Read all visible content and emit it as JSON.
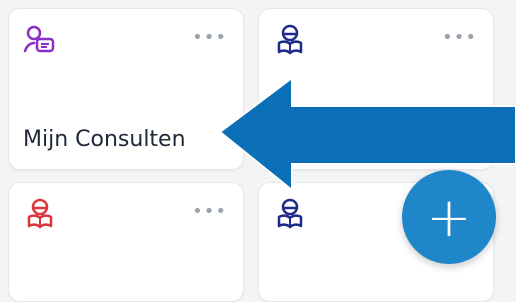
{
  "cards": [
    {
      "icon": "chat-person-icon",
      "title": "Mijn Consulten",
      "menu": "•••"
    },
    {
      "icon": "reader-icon",
      "title": "",
      "menu": "•••"
    },
    {
      "icon": "reader-icon",
      "title": "",
      "menu": "•••"
    },
    {
      "icon": "reader-icon",
      "title": "",
      "menu": ""
    }
  ],
  "fab_label": "+",
  "colors": {
    "purple": "#8b2fc9",
    "navy": "#1e2a8a",
    "red": "#d9363e",
    "arrow": "#0b6fb8",
    "fab": "#1f86c9"
  }
}
